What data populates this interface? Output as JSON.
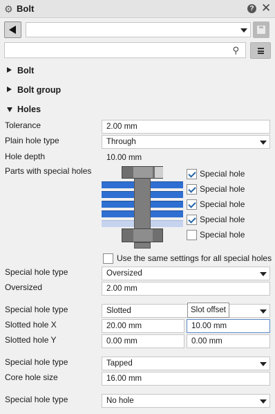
{
  "window": {
    "title": "Bolt",
    "icon": "gear-icon",
    "help_icon": "help-icon",
    "close_icon": "close-icon"
  },
  "toolbar": {
    "back_icon": "back-arrow-icon",
    "preset_value": "",
    "save_icon": "save-disk-icon"
  },
  "search": {
    "value": "",
    "icon": "search-icon",
    "menu_icon": "menu-icon"
  },
  "sections": {
    "bolt": "Bolt",
    "bolt_group": "Bolt group",
    "holes": "Holes"
  },
  "holes": {
    "tolerance_label": "Tolerance",
    "tolerance_value": "2.00 mm",
    "plain_hole_type_label": "Plain hole type",
    "plain_hole_type_value": "Through",
    "hole_depth_label": "Hole depth",
    "hole_depth_value": "10.00 mm",
    "parts_label": "Parts with special holes",
    "special_holes": [
      {
        "label": "Special hole",
        "checked": true
      },
      {
        "label": "Special hole",
        "checked": true
      },
      {
        "label": "Special hole",
        "checked": true
      },
      {
        "label": "Special hole",
        "checked": true
      },
      {
        "label": "Special hole",
        "checked": false
      }
    ],
    "same_settings_label": "Use the same settings for all special holes",
    "same_settings_checked": false,
    "groups": [
      {
        "type_label": "Special hole type",
        "type_value": "Oversized",
        "rows": [
          {
            "label": "Oversized",
            "value": "2.00 mm"
          }
        ]
      },
      {
        "type_label": "Special hole type",
        "type_value": "Slotted",
        "tooltip": "Slot offset",
        "rows": [
          {
            "label": "Slotted hole X",
            "value": "20.00 mm",
            "value2": "10.00 mm"
          },
          {
            "label": "Slotted hole Y",
            "value": "0.00 mm",
            "value2": "0.00 mm"
          }
        ]
      },
      {
        "type_label": "Special hole type",
        "type_value": "Tapped",
        "rows": [
          {
            "label": "Core hole size",
            "value": "16.00 mm"
          }
        ]
      },
      {
        "type_label": "Special hole type",
        "type_value": "No hole"
      }
    ]
  },
  "colors": {
    "plate_blue": "#2f6fd1",
    "plate_light": "#c6d3ee",
    "bolt_gray": "#6f6f6f",
    "checkmark": "#2565a8"
  }
}
